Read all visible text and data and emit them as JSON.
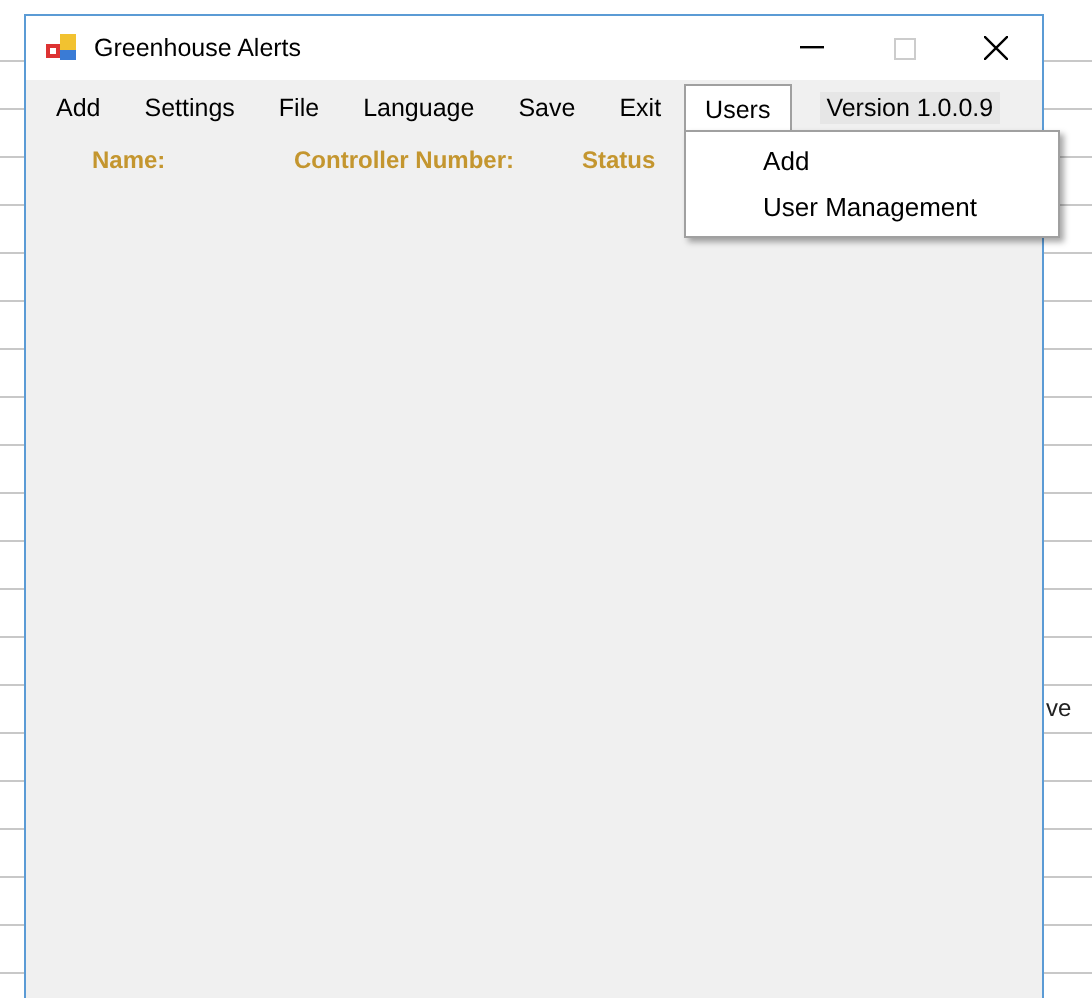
{
  "window": {
    "title": "Greenhouse Alerts"
  },
  "menu": [
    {
      "label": "Add",
      "selected": false
    },
    {
      "label": "Settings",
      "selected": false
    },
    {
      "label": "File",
      "selected": false
    },
    {
      "label": "Language",
      "selected": false
    },
    {
      "label": "Save",
      "selected": false
    },
    {
      "label": "Exit",
      "selected": false
    },
    {
      "label": "Users",
      "selected": true
    }
  ],
  "version": "Version 1.0.0.9",
  "dropdown": {
    "items": [
      "Add",
      "User Management"
    ]
  },
  "columns": [
    "Name:",
    "Controller Number:",
    "Status"
  ],
  "background_text": "ve"
}
